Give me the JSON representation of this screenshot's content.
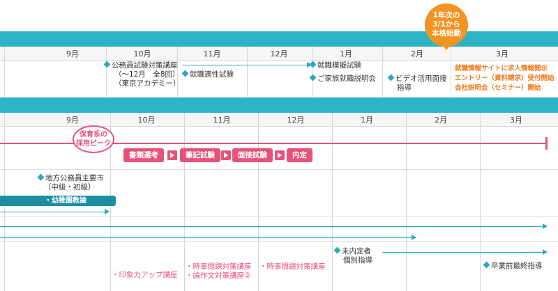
{
  "top_calendar": {
    "months": [
      "9月",
      "10月",
      "11月",
      "12月",
      "1月",
      "2月",
      "3月"
    ],
    "badge": {
      "line1": "1年次の",
      "line2": "3/1から",
      "line3": "本格始動"
    },
    "events": {
      "seminar_1": "公務員試験対策講座",
      "seminar_2": "（～12月　全8回）",
      "seminar_3": "（東京アカデミー）",
      "aptitude": "就職適性試験",
      "mock": "就職模擬試験",
      "family": "ご家族就職説明会",
      "video_1": "ビデオ活用面接",
      "video_2": "指導",
      "orange_1": "就職情報サイトに求人情報開示",
      "orange_2": "エントリー（資料請求）受付開始",
      "orange_3": "会社説明会（セミナー）開始"
    }
  },
  "bottom_calendar": {
    "months": [
      "9月",
      "10月",
      "11月",
      "12月",
      "1月",
      "2月",
      "3月"
    ],
    "peak": {
      "line1": "保育系の",
      "line2": "採用ピーク"
    },
    "flow": [
      "書類選考",
      "筆記試験",
      "面接試験",
      "内定"
    ],
    "civil_1": "地方公務員主要市",
    "civil_2": "（中級・初級）",
    "kindergarten": "・幼稚園教諭",
    "unplaced_1": "未内定者",
    "unplaced_2": "個別指導",
    "final": "卒業前最終指導",
    "impression": "・印象力アップ講座",
    "current_1": "・時事問題対策講座",
    "current_2": "・論作文対策講座③",
    "current_3": "・時事問題対策講座"
  },
  "colors": {
    "teal": "#2db3c6",
    "pink": "#e8527a",
    "orange": "#ee7a1a"
  }
}
